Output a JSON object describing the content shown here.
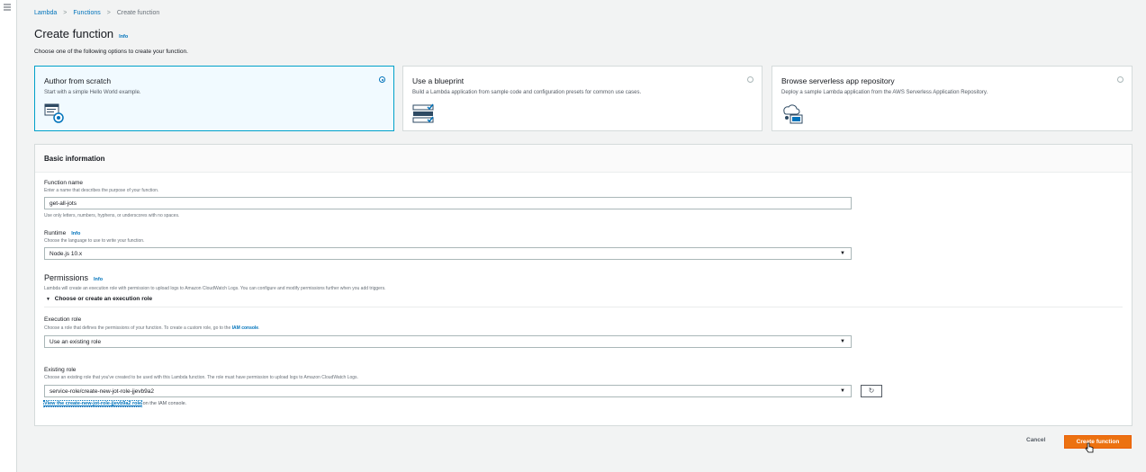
{
  "nav": {
    "menu_icon": "hamburger-icon"
  },
  "breadcrumb": {
    "items": [
      "Lambda",
      "Functions",
      "Create function"
    ],
    "separator": ">"
  },
  "page": {
    "title": "Create function",
    "info": "Info",
    "subtitle": "Choose one of the following options to create your function."
  },
  "options": [
    {
      "title": "Author from scratch",
      "description": "Start with a simple Hello World example.",
      "icon": "author-from-scratch-icon",
      "selected": true
    },
    {
      "title": "Use a blueprint",
      "description": "Build a Lambda application from sample code and configuration presets for common use cases.",
      "icon": "blueprint-icon",
      "selected": false
    },
    {
      "title": "Browse serverless app repository",
      "description": "Deploy a sample Lambda application from the AWS Serverless Application Repository.",
      "icon": "serverless-repo-icon",
      "selected": false
    }
  ],
  "basic": {
    "title": "Basic information",
    "function_name": {
      "label": "Function name",
      "description": "Enter a name that describes the purpose of your function.",
      "value": "get-all-jots",
      "hint": "Use only letters, numbers, hyphens, or underscores with no spaces."
    },
    "runtime": {
      "label": "Runtime",
      "info": "Info",
      "description": "Choose the language to use to write your function.",
      "value": "Node.js 10.x"
    },
    "permissions": {
      "title": "Permissions",
      "info": "Info",
      "description": "Lambda will create an execution role with permission to upload logs to Amazon CloudWatch Logs. You can configure and modify permissions further when you add triggers.",
      "expander": "Choose or create an execution role"
    },
    "execution_role": {
      "label": "Execution role",
      "description": "Choose a role that defines the permissions of your function. To create a custom role, go to the",
      "link": "IAM console",
      "link_suffix": ".",
      "value": "Use an existing role"
    },
    "existing_role": {
      "label": "Existing role",
      "description": "Choose an existing role that you've created to be used with this Lambda function. The role must have permission to upload logs to Amazon CloudWatch Logs.",
      "value": "service-role/create-new-jot-role-jjevb9a2",
      "view_link": "View the create-new-jot-role-jjevb9a2 role",
      "view_suffix": " on the IAM console."
    }
  },
  "footer": {
    "cancel": "Cancel",
    "create": "Create function"
  },
  "colors": {
    "accent": "#0073bb",
    "primary_button": "#ec7211",
    "selected_tile_bg": "#f1faff",
    "selected_tile_border": "#00a1c9"
  }
}
